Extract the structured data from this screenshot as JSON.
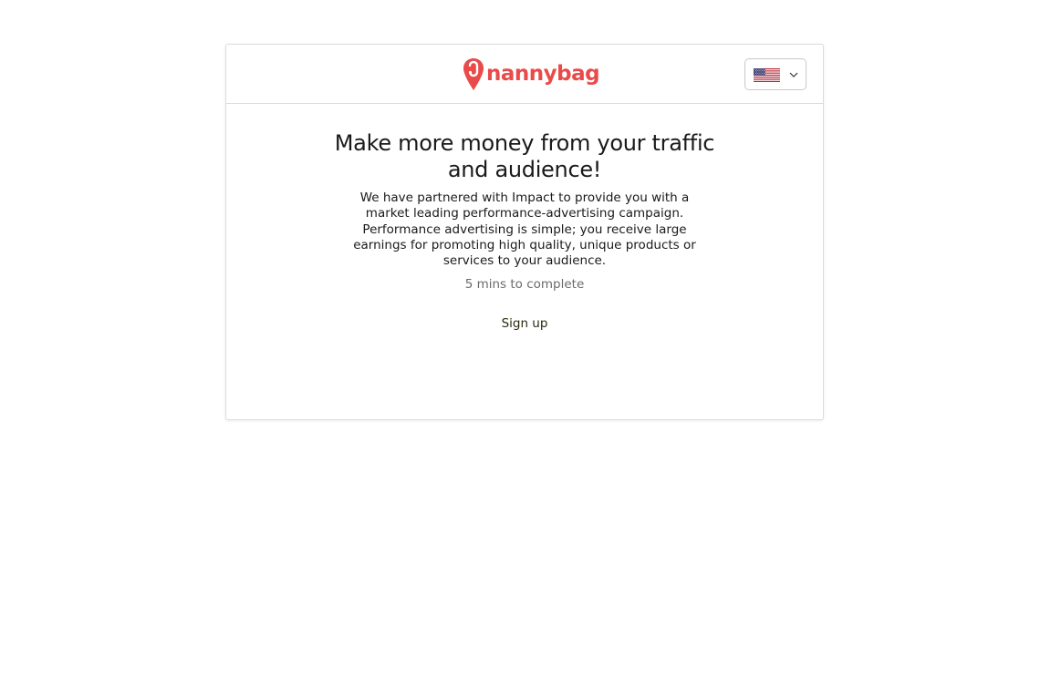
{
  "header": {
    "logo_text": "nannybag",
    "brand_color": "#e94a4a",
    "language_flag": "us-flag-icon"
  },
  "main": {
    "headline": "Make more money from your traffic and audience!",
    "description": "We have partnered with Impact to provide you with a market leading performance-advertising campaign. Performance advertising is simple; you receive large earnings for promoting high quality, unique products or services to your audience.",
    "time_estimate": "5 mins to complete",
    "signup_label": "Sign up"
  }
}
